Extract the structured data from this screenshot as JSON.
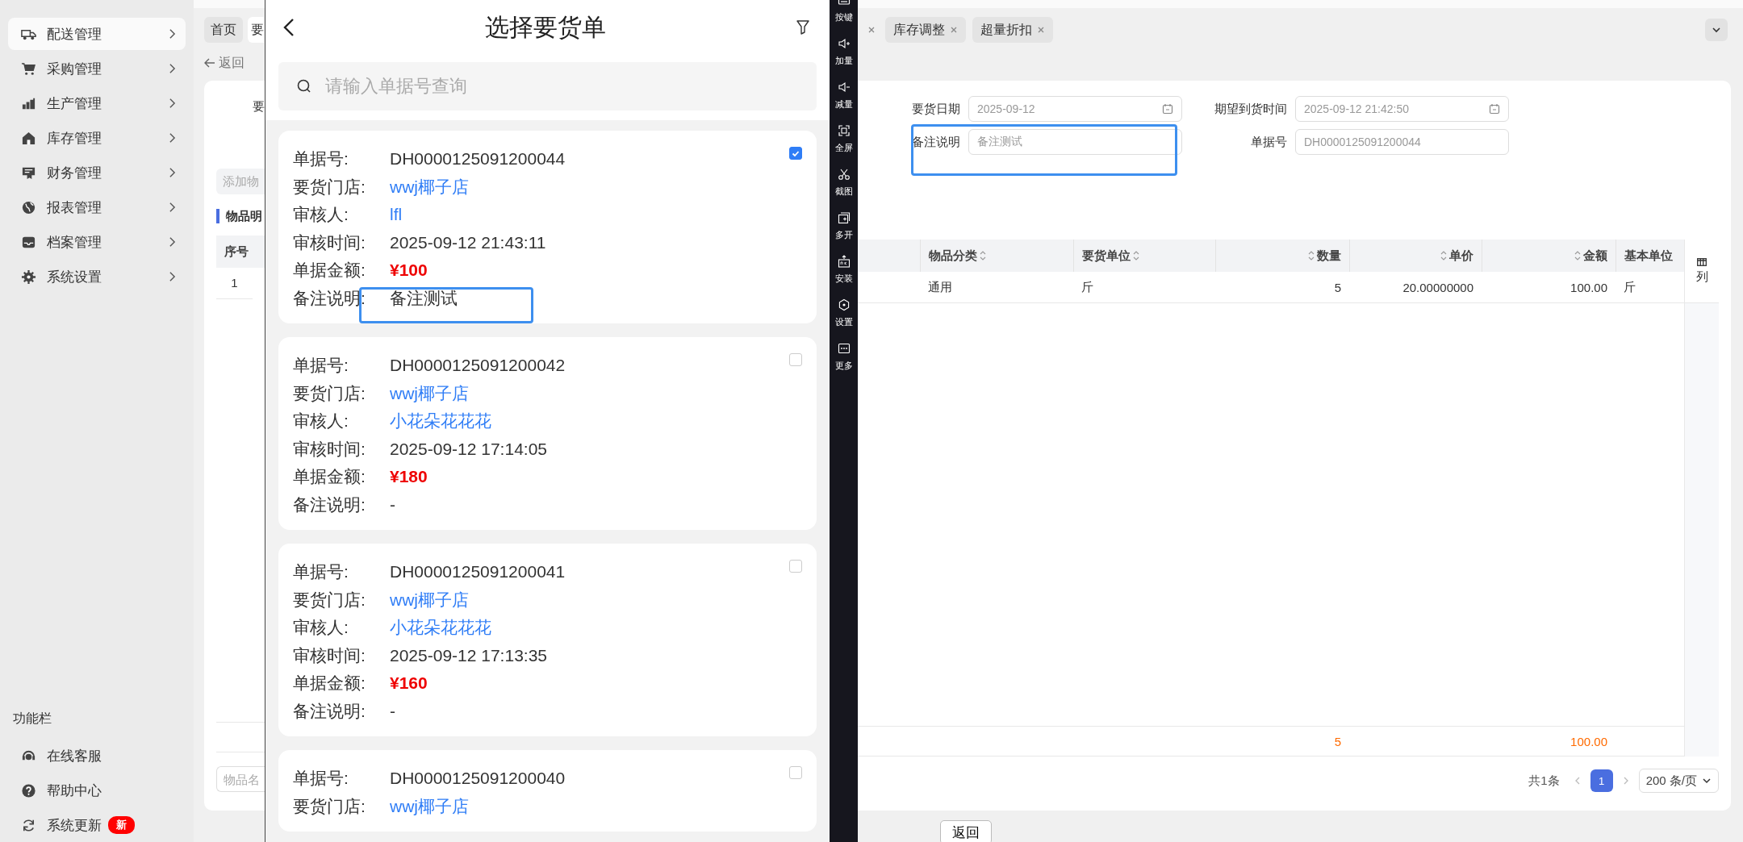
{
  "sidebar": {
    "items": [
      {
        "label": "配送管理",
        "selected": true
      },
      {
        "label": "采购管理",
        "selected": false
      },
      {
        "label": "生产管理",
        "selected": false
      },
      {
        "label": "库存管理",
        "selected": false
      },
      {
        "label": "财务管理",
        "selected": false
      },
      {
        "label": "报表管理",
        "selected": false
      },
      {
        "label": "档案管理",
        "selected": false
      },
      {
        "label": "系统设置",
        "selected": false
      }
    ],
    "footer_title": "功能栏",
    "footer_items": [
      {
        "label": "在线客服"
      },
      {
        "label": "帮助中心"
      },
      {
        "label": "系统更新",
        "badge": "新"
      }
    ]
  },
  "tabs": [
    {
      "label": "首页",
      "selected": false
    },
    {
      "label": "要",
      "selected": true
    }
  ],
  "right_tabs": [
    {
      "label": "库存调整",
      "selected": false
    },
    {
      "label": "超量折扣",
      "selected": false
    }
  ],
  "back_link": "返回",
  "form": {
    "left_label": "要",
    "rows": [
      [
        {
          "label": "要货日期",
          "value": "2025-09-12",
          "kind": "date",
          "disabled": true,
          "highlighted": false
        },
        {
          "label": "期望到货时间",
          "value": "2025-09-12 21:42:50",
          "kind": "date",
          "disabled": true,
          "highlighted": false
        }
      ],
      [
        {
          "label": "备注说明",
          "value": "备注测试",
          "kind": "text",
          "disabled": true,
          "highlighted": true
        },
        {
          "label": "单据号",
          "value": "DH0000125091200044",
          "kind": "text",
          "disabled": true,
          "highlighted": false
        }
      ]
    ]
  },
  "add_button": "添加物",
  "section_title": "物品明",
  "table": {
    "left_header": "序号",
    "left_rows": [
      "1"
    ],
    "columns": [
      {
        "label": "物品分类",
        "numeric": false,
        "sortable": true
      },
      {
        "label": "要货单位",
        "numeric": false,
        "sortable": true
      },
      {
        "label": "数量",
        "numeric": true,
        "sortable": true
      },
      {
        "label": "单价",
        "numeric": true,
        "sortable": true
      },
      {
        "label": "金额",
        "numeric": true,
        "sortable": true
      },
      {
        "label": "基本单位",
        "numeric": false,
        "sortable": false
      }
    ],
    "rows": [
      [
        "通用",
        "斤",
        "5",
        "20.00000000",
        "100.00",
        "斤"
      ]
    ],
    "summary_quantity": "5",
    "summary_amount": "100.00",
    "column_settings": "列"
  },
  "item_search": {
    "placeholder": "物品名"
  },
  "pagination": {
    "total": "共1条",
    "pages": [
      {
        "label": "1",
        "selected": true
      }
    ],
    "page_size": "200 条/页"
  },
  "footer_button": "返回",
  "phone": {
    "title": "选择要货单",
    "search_placeholder": "请输入单据号查询",
    "orders": [
      {
        "checked": true,
        "fields": [
          {
            "label": "单据号:",
            "value": "DH0000125091200044",
            "kind": "text",
            "highlighted": false
          },
          {
            "label": "要货门店:",
            "value": "wwj椰子店",
            "kind": "link",
            "highlighted": false
          },
          {
            "label": "审核人:",
            "value": "lfl",
            "kind": "link",
            "highlighted": false
          },
          {
            "label": "审核时间:",
            "value": "2025-09-12 21:43:11",
            "kind": "text",
            "highlighted": false
          },
          {
            "label": "单据金额:",
            "value": "¥100",
            "kind": "amount",
            "highlighted": false
          },
          {
            "label": "备注说明:",
            "value": "备注测试",
            "kind": "text",
            "highlighted": true
          }
        ]
      },
      {
        "checked": false,
        "fields": [
          {
            "label": "单据号:",
            "value": "DH0000125091200042",
            "kind": "text",
            "highlighted": false
          },
          {
            "label": "要货门店:",
            "value": "wwj椰子店",
            "kind": "link",
            "highlighted": false
          },
          {
            "label": "审核人:",
            "value": "小花朵花花花",
            "kind": "link",
            "highlighted": false
          },
          {
            "label": "审核时间:",
            "value": "2025-09-12 17:14:05",
            "kind": "text",
            "highlighted": false
          },
          {
            "label": "单据金额:",
            "value": "¥180",
            "kind": "amount",
            "highlighted": false
          },
          {
            "label": "备注说明:",
            "value": "-",
            "kind": "text",
            "highlighted": false
          }
        ]
      },
      {
        "checked": false,
        "fields": [
          {
            "label": "单据号:",
            "value": "DH0000125091200041",
            "kind": "text",
            "highlighted": false
          },
          {
            "label": "要货门店:",
            "value": "wwj椰子店",
            "kind": "link",
            "highlighted": false
          },
          {
            "label": "审核人:",
            "value": "小花朵花花花",
            "kind": "link",
            "highlighted": false
          },
          {
            "label": "审核时间:",
            "value": "2025-09-12 17:13:35",
            "kind": "text",
            "highlighted": false
          },
          {
            "label": "单据金额:",
            "value": "¥160",
            "kind": "amount",
            "highlighted": false
          },
          {
            "label": "备注说明:",
            "value": "-",
            "kind": "text",
            "highlighted": false
          }
        ]
      },
      {
        "checked": false,
        "fields": [
          {
            "label": "单据号:",
            "value": "DH0000125091200040",
            "kind": "text",
            "highlighted": false
          },
          {
            "label": "要货门店:",
            "value": "wwj椰子店",
            "kind": "link",
            "highlighted": false
          }
        ]
      }
    ]
  },
  "toolbar": [
    {
      "label": "按键"
    },
    {
      "label": "加量"
    },
    {
      "label": "减量"
    },
    {
      "label": "全屏"
    },
    {
      "label": "截图"
    },
    {
      "label": "多开"
    },
    {
      "label": "安装"
    },
    {
      "label": "设置"
    },
    {
      "label": "更多"
    }
  ]
}
